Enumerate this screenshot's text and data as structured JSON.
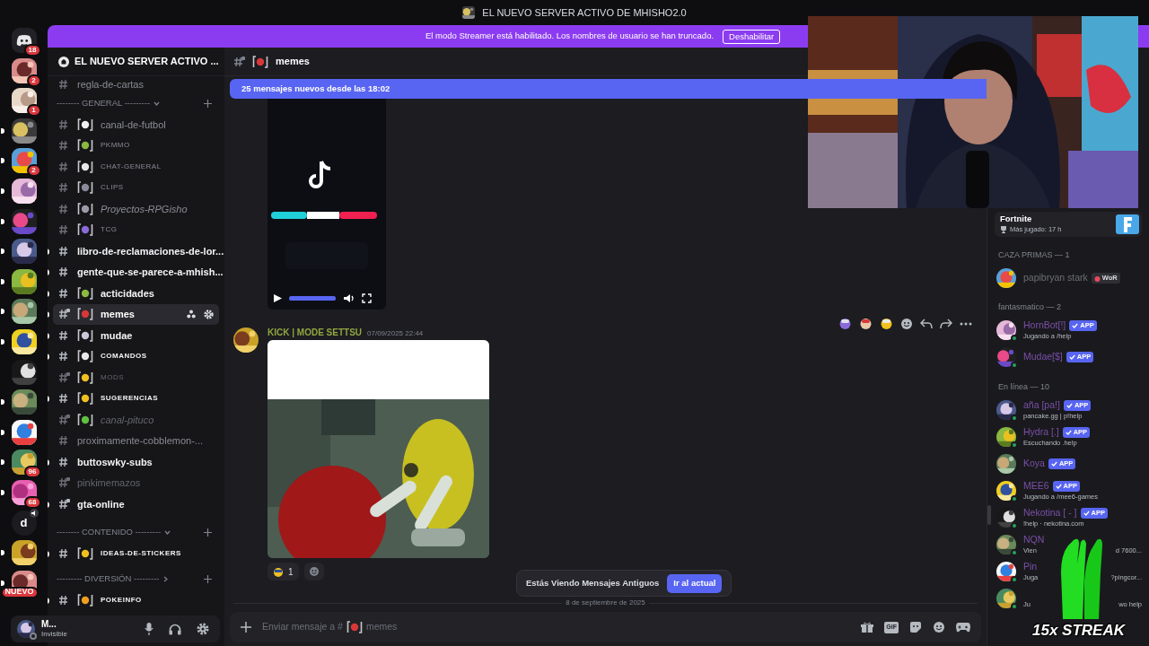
{
  "window": {
    "title": "EL NUEVO SERVER ACTIVO DE MHISHO2.0"
  },
  "servers": [
    {
      "kind": "logo",
      "badge": "18",
      "unread": false
    },
    {
      "kind": "picture",
      "badge": "2",
      "unread": false
    },
    {
      "kind": "picture",
      "badge": "1",
      "unread": false
    },
    {
      "kind": "picture",
      "unread": true
    },
    {
      "kind": "picture",
      "badge": "2",
      "unread": true
    },
    {
      "kind": "picture",
      "unread": true
    },
    {
      "kind": "picture",
      "unread": true
    },
    {
      "kind": "picture",
      "unread": true
    },
    {
      "kind": "picture",
      "unread": true
    },
    {
      "kind": "picture",
      "unread": true
    },
    {
      "kind": "picture",
      "unread": true
    },
    {
      "kind": "picture",
      "unread": false
    },
    {
      "kind": "picture",
      "unread": true
    },
    {
      "kind": "picture",
      "unread": true
    },
    {
      "kind": "picture",
      "badge": "96",
      "unread": true
    },
    {
      "kind": "picture",
      "badge": "68",
      "unread": true
    },
    {
      "kind": "letter",
      "text": "d",
      "voice": true,
      "unread": false
    },
    {
      "kind": "picture",
      "unread": true
    },
    {
      "kind": "picture",
      "badge": "NUEVO",
      "unread": true
    }
  ],
  "banner": {
    "text": "El modo Streamer está habilitado. Los nombres de usuario se han truncado.",
    "button": "Deshabilitar"
  },
  "server_header": {
    "title": "EL NUEVO SERVER ACTIVO ..."
  },
  "channels": [
    {
      "kind": "channel",
      "name": "regla-de-cartas",
      "unread": false,
      "muted": false,
      "selected": false
    },
    {
      "kind": "category",
      "label": "-------- GENERAL ---------",
      "expanded": true
    },
    {
      "kind": "channel",
      "name": "canal-de-futbol",
      "emoji": true,
      "unread": false,
      "muted": false,
      "selected": false
    },
    {
      "kind": "channel",
      "name": "PKMMO",
      "emoji": true,
      "caps": true,
      "unread": false,
      "muted": false,
      "selected": false
    },
    {
      "kind": "channel",
      "name": "CHAT-GENERAL",
      "emoji": true,
      "caps": true,
      "unread": false,
      "muted": false,
      "selected": false
    },
    {
      "kind": "channel",
      "name": "CLIPS",
      "emoji": true,
      "caps": true,
      "unread": false,
      "muted": false,
      "selected": false
    },
    {
      "kind": "channel",
      "name": "Proyectos-RPGisho",
      "emoji": true,
      "italic": true,
      "unread": false,
      "muted": false,
      "selected": false
    },
    {
      "kind": "channel",
      "name": "TCG",
      "emoji": true,
      "caps": true,
      "unread": false,
      "muted": false,
      "selected": false
    },
    {
      "kind": "channel",
      "name": "libro-de-reclamaciones-de-lor...",
      "unread": true,
      "muted": false,
      "selected": false
    },
    {
      "kind": "channel",
      "name": "gente-que-se-parece-a-mhish...",
      "unread": true,
      "muted": false,
      "selected": false
    },
    {
      "kind": "channel",
      "name": "acticidades",
      "emoji": true,
      "unread": true,
      "muted": false,
      "selected": false
    },
    {
      "kind": "channel",
      "name": "memes",
      "emoji": true,
      "locked": true,
      "unread": true,
      "muted": false,
      "selected": true
    },
    {
      "kind": "channel",
      "name": "mudae",
      "emoji": true,
      "unread": true,
      "muted": false,
      "selected": false
    },
    {
      "kind": "channel",
      "name": "COMANDOS",
      "emoji": true,
      "caps": true,
      "unread": true,
      "muted": false,
      "selected": false
    },
    {
      "kind": "channel",
      "name": "MODS",
      "emoji": true,
      "caps": true,
      "locked": true,
      "unread": false,
      "muted": true,
      "selected": false
    },
    {
      "kind": "channel",
      "name": "SUGERENCIAS",
      "emoji": true,
      "caps": true,
      "unread": true,
      "muted": false,
      "selected": false
    },
    {
      "kind": "channel",
      "name": "canal-pituco",
      "emoji": true,
      "italic": true,
      "locked": true,
      "unread": false,
      "muted": true,
      "selected": false
    },
    {
      "kind": "channel",
      "name": "proximamente-cobblemon-...",
      "unread": false,
      "muted": false,
      "selected": false
    },
    {
      "kind": "channel",
      "name": "buttoswky-subs",
      "unread": true,
      "muted": false,
      "selected": false
    },
    {
      "kind": "channel",
      "name": "pinkimemazos",
      "locked": true,
      "unread": false,
      "muted": true,
      "selected": false
    },
    {
      "kind": "channel",
      "name": "gta-online",
      "locked": true,
      "unread": true,
      "muted": false,
      "selected": false
    },
    {
      "kind": "category",
      "label": "-------- CONTENIDO ---------",
      "expanded": true
    },
    {
      "kind": "channel",
      "name": "IDEAS-DE-STICKERS",
      "emoji": true,
      "caps": true,
      "unread": true,
      "muted": false,
      "selected": false
    },
    {
      "kind": "category",
      "label": "--------- DIVERSIÓN ---------",
      "expanded": false
    },
    {
      "kind": "channel",
      "name": "POKEINFO",
      "emoji": true,
      "caps": true,
      "unread": true,
      "muted": false,
      "selected": false
    }
  ],
  "user_panel": {
    "name": "M...",
    "status": "Invisible"
  },
  "chat_header": {
    "channel": "memes"
  },
  "new_messages": "25 mensajes nuevos desde las 18:02",
  "video": {
    "kind": "picture",
    "level": 1
  },
  "message": {
    "author": "KICK | MODE SETTSU",
    "color": "#8fa640",
    "time": "07/09/2025 22:44",
    "attachment": {
      "kind": "picture"
    },
    "reactions": [
      {
        "count": "1"
      }
    ]
  },
  "toast": {
    "text": "Estás Viendo Mensajes Antiguos",
    "button": "Ir al actual"
  },
  "date_divider": "8 de septiembre de 2025",
  "composer": {
    "placeholder": "Enviar mensaje a #",
    "channel": "memes",
    "gif": "GIF"
  },
  "members": {
    "activity": {
      "title": "Fortnite",
      "detail": "Más jugado: 17 h"
    },
    "groups": [
      {
        "label": "CAZA PRIMAS — 1",
        "members": [
          {
            "name": "papibryan stark",
            "color": "#6d6f75",
            "tag": "WoR",
            "online": false
          }
        ]
      },
      {
        "label": "fantasmatico — 2",
        "members": [
          {
            "name": "HornBot[!]",
            "color": "#7a4fa8",
            "badge": "APP",
            "status": "Jugando a /help",
            "online": true
          },
          {
            "name": "Mudae[$]",
            "color": "#7a4fa8",
            "badge": "APP",
            "online": true
          }
        ]
      },
      {
        "label": "En línea — 10",
        "members": [
          {
            "name": "aña [pa!]",
            "color": "#7a4fa8",
            "badge": "APP",
            "status": "pancake.gg | p!help",
            "online": true
          },
          {
            "name": "Hydra [.]",
            "color": "#7a4fa8",
            "badge": "APP",
            "status": "Escuchando .help",
            "online": true
          },
          {
            "name": "Koya",
            "color": "#7a4fa8",
            "badge": "APP",
            "online": false
          },
          {
            "name": "MEE6",
            "color": "#7a4fa8",
            "badge": "APP",
            "status": "Jugando a /mee6-games",
            "online": true
          },
          {
            "name": "Nekotina [ - ]",
            "color": "#7a4fa8",
            "badge": "APP",
            "status": "!help · nekotina.com",
            "online": true
          },
          {
            "name": "NQN",
            "color": "#7a4fa8",
            "status": "Vien",
            "status_tail": "d 7600...",
            "online": true
          },
          {
            "name": "Pin",
            "color": "#7a4fa8",
            "status": "Juga",
            "status_tail": "?pingcor...",
            "online": true
          },
          {
            "status": "Ju",
            "status_tail": "wo help",
            "online": true
          }
        ]
      }
    ]
  },
  "overlay": {
    "streak": "15x STREAK"
  }
}
